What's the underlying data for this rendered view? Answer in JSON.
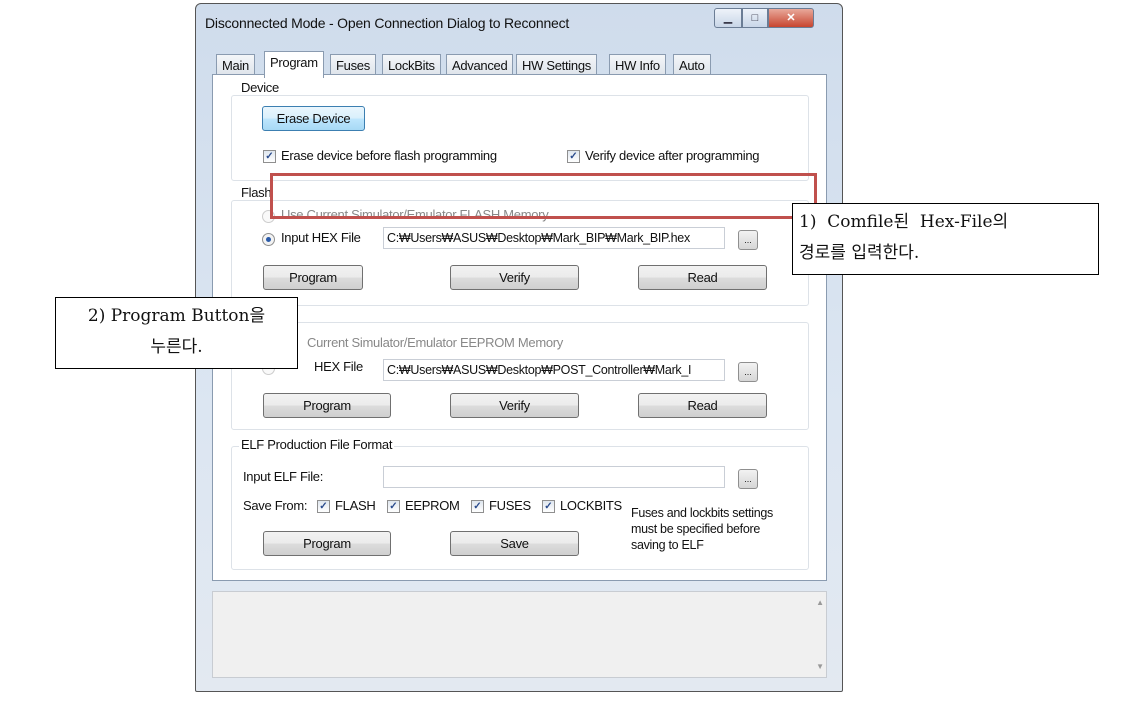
{
  "window": {
    "title": "Disconnected Mode - Open Connection Dialog to Reconnect",
    "controls": [
      "minimize",
      "maximize",
      "close"
    ]
  },
  "tabs": [
    {
      "label": "Main"
    },
    {
      "label": "Program",
      "active": true
    },
    {
      "label": "Fuses"
    },
    {
      "label": "LockBits"
    },
    {
      "label": "Advanced"
    },
    {
      "label": "HW Settings"
    },
    {
      "label": "HW Info"
    },
    {
      "label": "Auto"
    }
  ],
  "device": {
    "group_label": "Device",
    "erase_button": "Erase Device",
    "erase_before_flash": {
      "label": "Erase device before flash programming",
      "checked": true
    },
    "verify_after": {
      "label": "Verify device after programming",
      "checked": true
    }
  },
  "flash": {
    "group_label": "Flash",
    "use_simulator": {
      "label": "Use Current Simulator/Emulator FLASH Memory",
      "selected": false,
      "disabled": true
    },
    "input_hex": {
      "label": "Input HEX File",
      "selected": true
    },
    "path": "C:₩Users₩ASUS₩Desktop₩Mark_BIP₩Mark_BIP.hex",
    "browse": "...",
    "program": "Program",
    "verify": "Verify",
    "read": "Read"
  },
  "eeprom": {
    "use_simulator": {
      "label": "Current Simulator/Emulator EEPROM Memory"
    },
    "input_hex": {
      "label": "HEX File"
    },
    "path": "C:₩Users₩ASUS₩Desktop₩POST_Controller₩Mark_I",
    "browse": "...",
    "program": "Program",
    "verify": "Verify",
    "read": "Read"
  },
  "elf": {
    "group_label": "ELF Production File Format",
    "input_label": "Input ELF File:",
    "input_value": "",
    "browse": "...",
    "save_from_label": "Save From:",
    "checks": [
      {
        "label": "FLASH",
        "checked": true
      },
      {
        "label": "EEPROM",
        "checked": true
      },
      {
        "label": "FUSES",
        "checked": true
      },
      {
        "label": "LOCKBITS",
        "checked": true
      }
    ],
    "note_lines": [
      "Fuses and lockbits settings",
      "must be specified before",
      "saving to ELF"
    ],
    "program": "Program",
    "save": "Save"
  },
  "log": {
    "content": ""
  },
  "annotations": {
    "callout1_lines": [
      "1)  Comfile된  Hex-File의",
      "경로를 입력한다."
    ],
    "callout2_lines": [
      "2) Program Button을",
      "누른다."
    ],
    "highlight_color": "#c0504d"
  }
}
